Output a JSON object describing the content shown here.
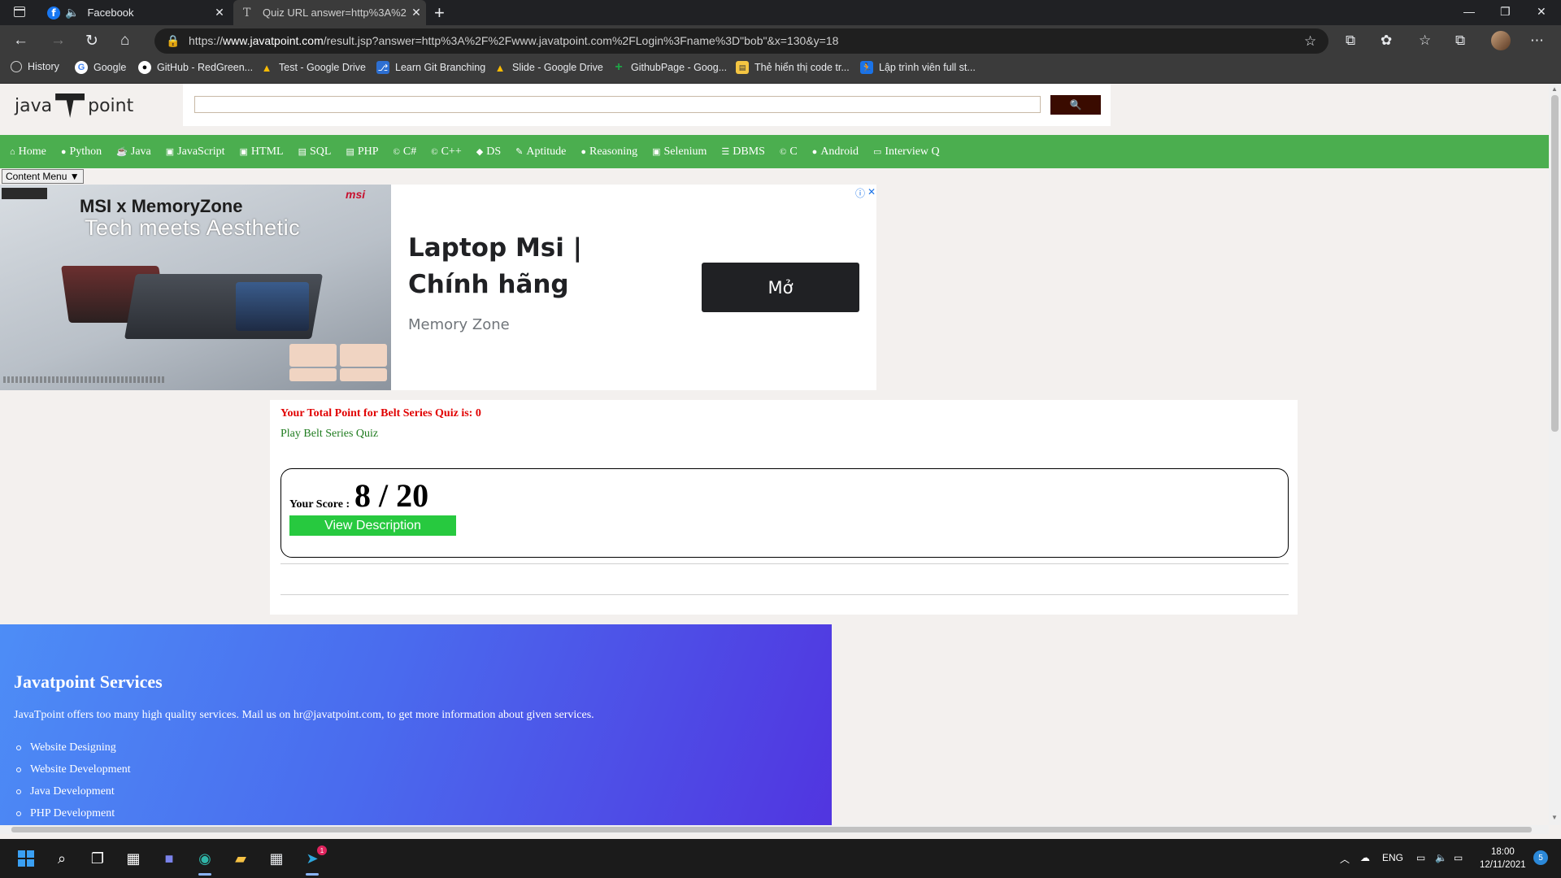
{
  "browser": {
    "tabs": [
      {
        "title": "Facebook",
        "icon": "facebook-icon"
      },
      {
        "title": "Quiz URL answer=http%3A%2F%",
        "icon": "page-icon"
      }
    ],
    "new_tab_label": "+",
    "url_prefix": "https://",
    "url_host": "www.javatpoint.com",
    "url_path": "/result.jsp?answer=http%3A%2F%2Fwww.javatpoint.com%2FLogin%3Fname%3D\"bob\"&x=130&y=18",
    "bookmarks": [
      {
        "label": "History",
        "icon": "history-icon",
        "color": "#5f6368"
      },
      {
        "label": "Google",
        "icon": "google-icon",
        "color": "#ffffff"
      },
      {
        "label": "GitHub - RedGreen...",
        "icon": "github-icon",
        "color": "#ffffff"
      },
      {
        "label": "Test - Google Drive",
        "icon": "drive-icon",
        "color": "#fbbc04"
      },
      {
        "label": "Learn Git Branching",
        "icon": "git-icon",
        "color": "#2d6fd2"
      },
      {
        "label": "Slide - Google Drive",
        "icon": "drive-icon",
        "color": "#fbbc04"
      },
      {
        "label": "GithubPage - Goog...",
        "icon": "sheets-icon",
        "color": "#1e8e3e"
      },
      {
        "label": "Thẻ hiển thị code tr...",
        "icon": "note-icon",
        "color": "#f4c542"
      },
      {
        "label": "Lập trình viên full st...",
        "icon": "runner-icon",
        "color": "#1a73e8"
      }
    ]
  },
  "site": {
    "logo_left": "java",
    "logo_right": "point",
    "search_button_icon": "search-icon",
    "nav": [
      "Home",
      "Python",
      "Java",
      "JavaScript",
      "HTML",
      "SQL",
      "PHP",
      "C#",
      "C++",
      "DS",
      "Aptitude",
      "Reasoning",
      "Selenium",
      "DBMS",
      "C",
      "Android",
      "Interview Q"
    ],
    "content_menu": "Content Menu ▼"
  },
  "ad": {
    "image_brand": "MSI x MemoryZone",
    "image_tagline": "Tech meets Aesthetic",
    "image_msi": "msi",
    "title": "Laptop Msi | Chính hãng",
    "subtitle": "Memory Zone",
    "cta": "Mở"
  },
  "result": {
    "total_point": "Your Total Point for Belt Series Quiz is: 0",
    "play_link": "Play Belt Series Quiz",
    "score_label": "Your Score :",
    "score_value": "8 / 20",
    "view_description": "View Description"
  },
  "services": {
    "title": "Javatpoint Services",
    "description": "JavaTpoint offers too many high quality services. Mail us on hr@javatpoint.com, to get more information about given services.",
    "items": [
      "Website Designing",
      "Website Development",
      "Java Development",
      "PHP Development"
    ]
  },
  "taskbar": {
    "language": "ENG",
    "time": "18:00",
    "date": "12/11/2021",
    "notification_count": "5",
    "telegram_badge": "1"
  }
}
